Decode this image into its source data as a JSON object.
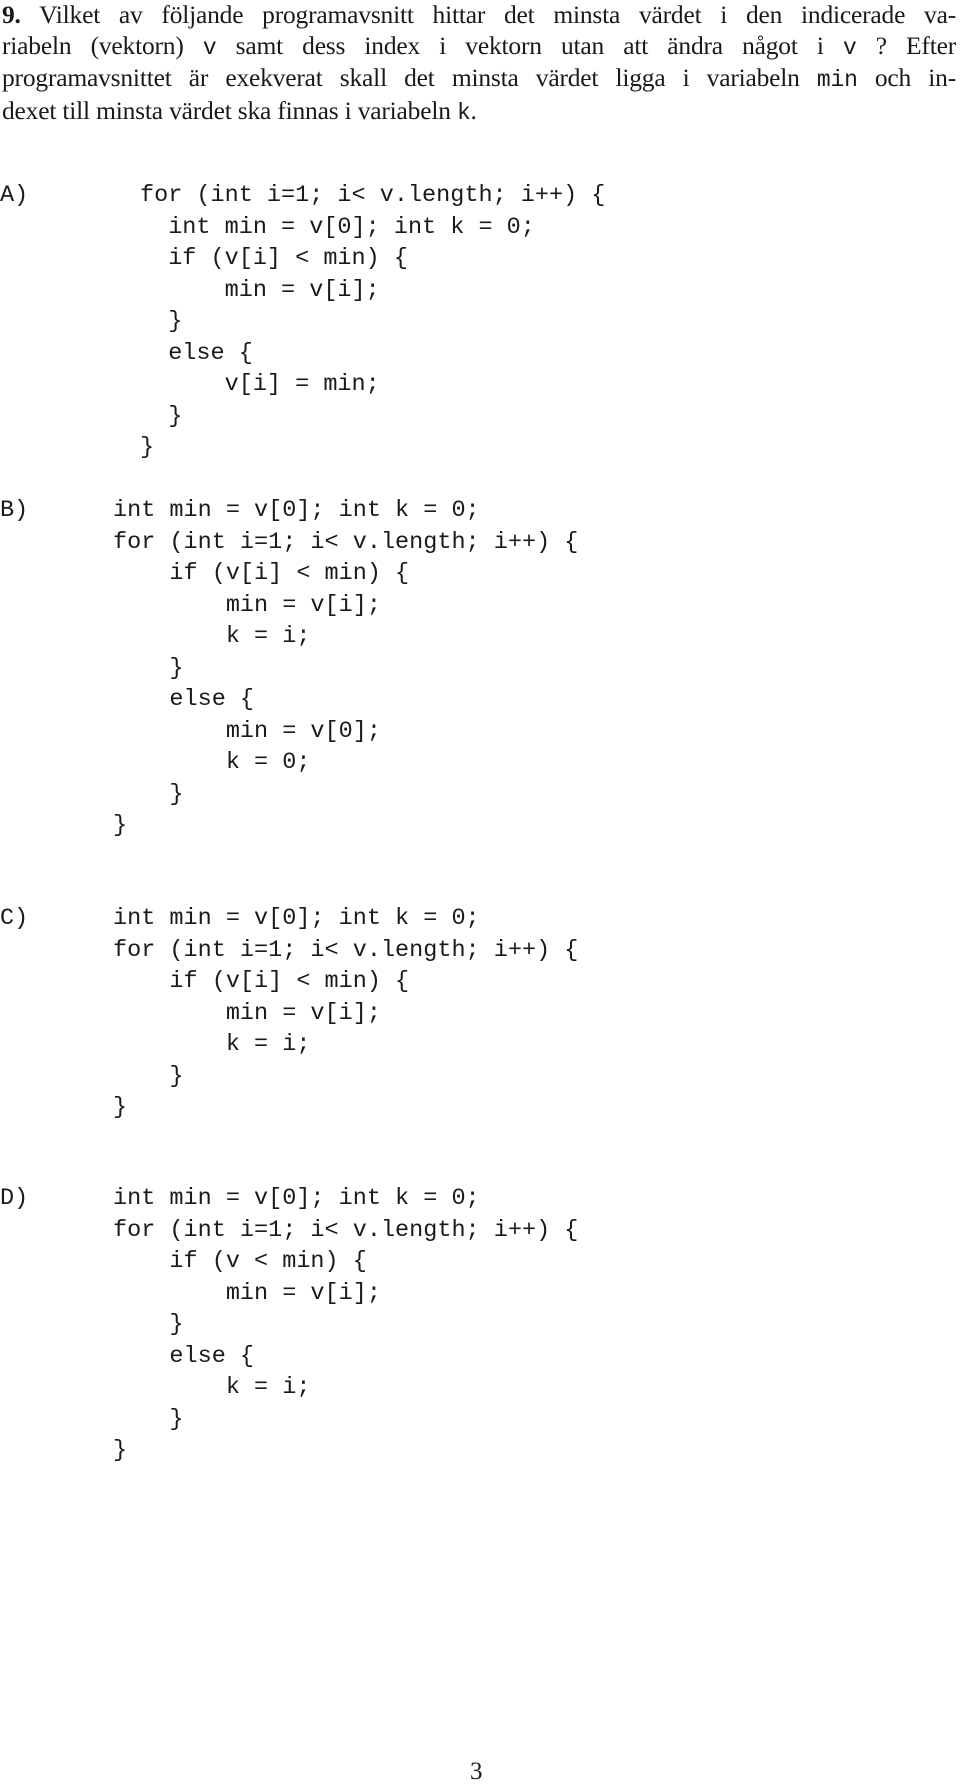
{
  "question": {
    "number": "9.",
    "lines": [
      {
        "parts": [
          {
            "t": "Vilket av följande programavsnitt hittar det minsta värdet i den indicerade va-"
          }
        ]
      },
      {
        "parts": [
          {
            "t": "riabeln (vektorn) "
          },
          {
            "t": "v",
            "code": true
          },
          {
            "t": " samt dess index i vektorn utan att ändra något i "
          },
          {
            "t": "v",
            "code": true
          },
          {
            "t": " ? Efter"
          }
        ]
      },
      {
        "parts": [
          {
            "t": "programavsnittet är exekverat skall det minsta värdet ligga i variabeln "
          },
          {
            "t": "min",
            "code": true
          },
          {
            "t": " och in-"
          }
        ]
      },
      {
        "parts": [
          {
            "t": "dexet till minsta värdet ska finnas i variabeln "
          },
          {
            "t": "k",
            "code": true
          },
          {
            "t": "."
          }
        ]
      }
    ]
  },
  "options": [
    {
      "label": "A)",
      "lines": [
        "for (int i=1; i< v.length; i++) {",
        "  int min = v[0]; int k = 0;",
        "  if (v[i] < min) {",
        "      min = v[i];",
        "  }",
        "  else {",
        "      v[i] = min;",
        "  }",
        "}"
      ]
    },
    {
      "label": "B)",
      "lines": [
        "int min = v[0]; int k = 0;",
        "for (int i=1; i< v.length; i++) {",
        "    if (v[i] < min) {",
        "        min = v[i];",
        "        k = i;",
        "    }",
        "    else {",
        "        min = v[0];",
        "        k = 0;",
        "    }",
        "}"
      ]
    },
    {
      "label": "C)",
      "lines": [
        "int min = v[0]; int k = 0;",
        "for (int i=1; i< v.length; i++) {",
        "    if (v[i] < min) {",
        "        min = v[i];",
        "        k = i;",
        "    }",
        "}"
      ]
    },
    {
      "label": "D)",
      "lines": [
        "int min = v[0]; int k = 0;",
        "for (int i=1; i< v.length; i++) {",
        "    if (v < min) {",
        "        min = v[i];",
        "    }",
        "    else {",
        "        k = i;",
        "    }",
        "}"
      ]
    }
  ],
  "page_number": "3"
}
